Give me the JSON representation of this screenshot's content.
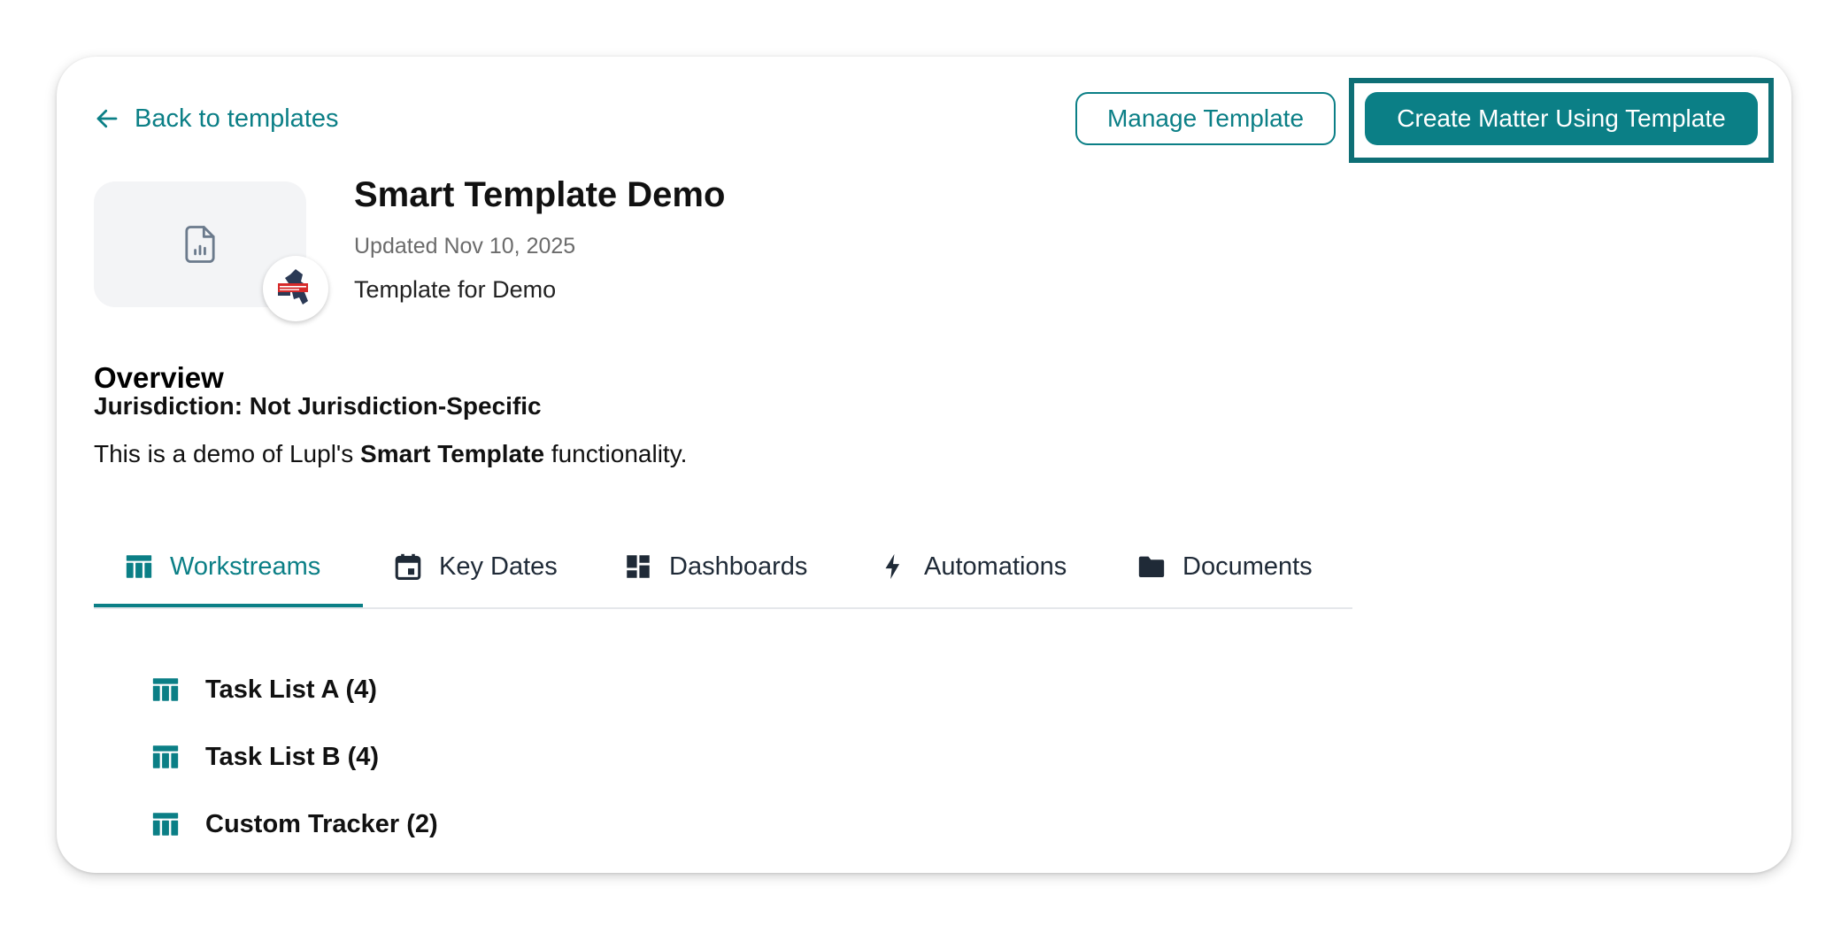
{
  "header": {
    "back_label": "Back to templates",
    "manage_label": "Manage Template",
    "create_label": "Create Matter Using Template"
  },
  "template": {
    "title": "Smart Template Demo",
    "updated": "Updated Nov 10, 2025",
    "description": "Template for Demo"
  },
  "overview": {
    "heading": "Overview",
    "jurisdiction": "Jurisdiction: Not Jurisdiction-Specific",
    "text_before": "This is a demo of Lupl's ",
    "text_bold": "Smart Template",
    "text_after": " functionality."
  },
  "tabs": [
    {
      "label": "Workstreams",
      "icon": "table-icon",
      "active": true
    },
    {
      "label": "Key Dates",
      "icon": "calendar-icon",
      "active": false
    },
    {
      "label": "Dashboards",
      "icon": "dashboard-icon",
      "active": false
    },
    {
      "label": "Automations",
      "icon": "bolt-icon",
      "active": false
    },
    {
      "label": "Documents",
      "icon": "folder-icon",
      "active": false
    }
  ],
  "workstreams": [
    {
      "label": "Task List A (4)"
    },
    {
      "label": "Task List B (4)"
    },
    {
      "label": "Custom Tracker (2)"
    }
  ],
  "colors": {
    "accent": "#0b7f86",
    "highlight_frame": "#0e6f76",
    "tab_text": "#1f2a37"
  }
}
